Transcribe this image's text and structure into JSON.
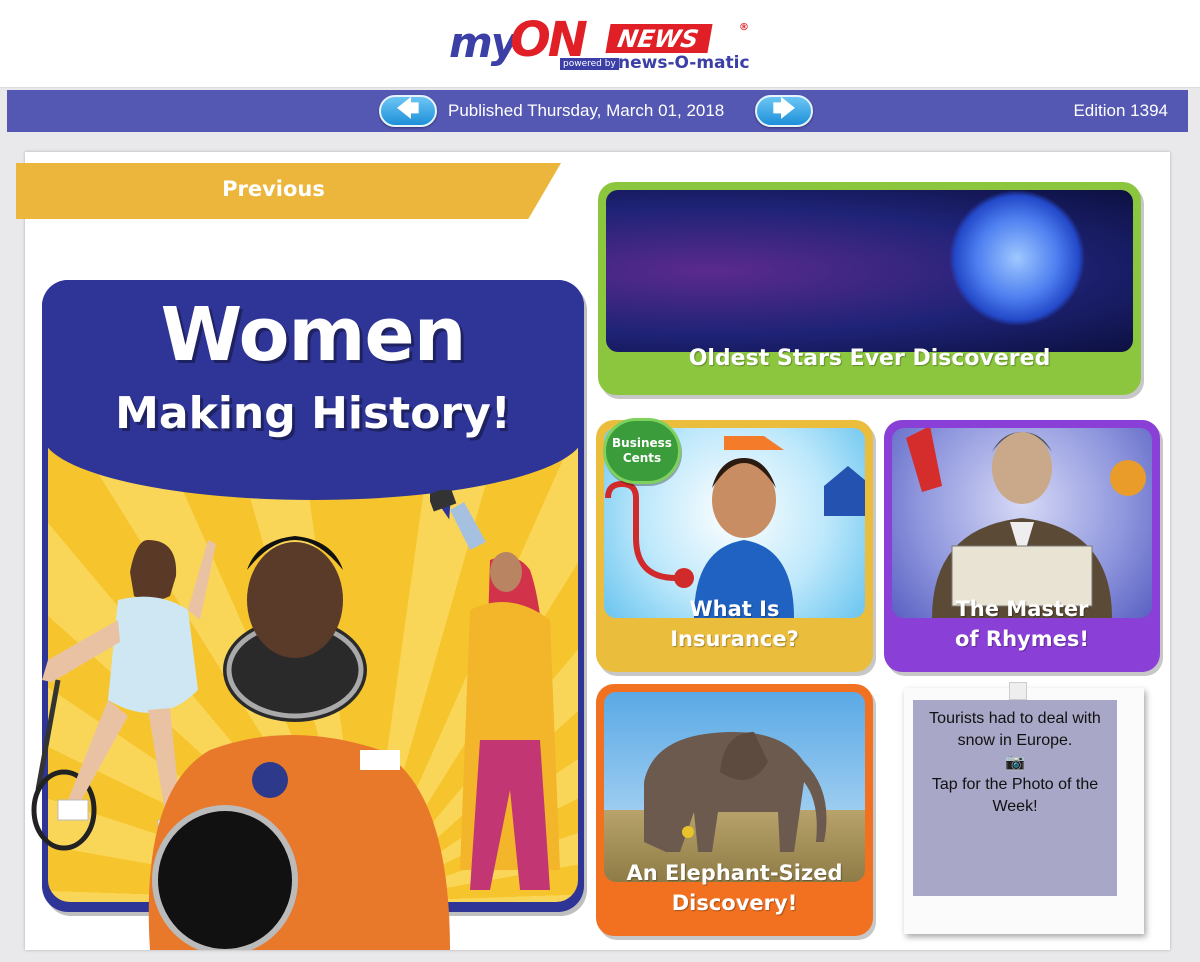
{
  "header": {
    "logo": {
      "my": "my",
      "on": "ON",
      "news": "NEWS",
      "reg": "®",
      "powered_by": "powered by",
      "news_o_matic": "news-O-matic"
    }
  },
  "edition_bar": {
    "prev_arrow": "🡄",
    "next_arrow": "🡆",
    "published": "Published Thursday, March 01, 2018",
    "edition": "Edition 1394"
  },
  "previous_banner": "Previous",
  "main_story": {
    "title_line1": "Women",
    "title_line2": "Making History!"
  },
  "tiles": {
    "stars": {
      "label": "Oldest Stars Ever Discovered"
    },
    "insurance": {
      "label_line1": "What Is",
      "label_line2": "Insurance?",
      "badge": "Business Cents"
    },
    "rhymes": {
      "label_line1": "The Master",
      "label_line2": "of Rhymes!"
    },
    "elephant": {
      "label_line1": "An Elephant-Sized",
      "label_line2": "Discovery!"
    }
  },
  "photo_of_week": {
    "line1": "Tourists had to deal with snow in Europe.",
    "camera": "📷",
    "line2": "Tap for the Photo of the Week!"
  },
  "colors": {
    "brand_blue": "#3b3fa6",
    "brand_red": "#e01f26",
    "bar": "#5458b3",
    "previous": "#ecb53c",
    "stars": "#8cc63f",
    "insurance": "#ebbd3d",
    "rhymes": "#8a3fd6",
    "elephant": "#f27121"
  }
}
